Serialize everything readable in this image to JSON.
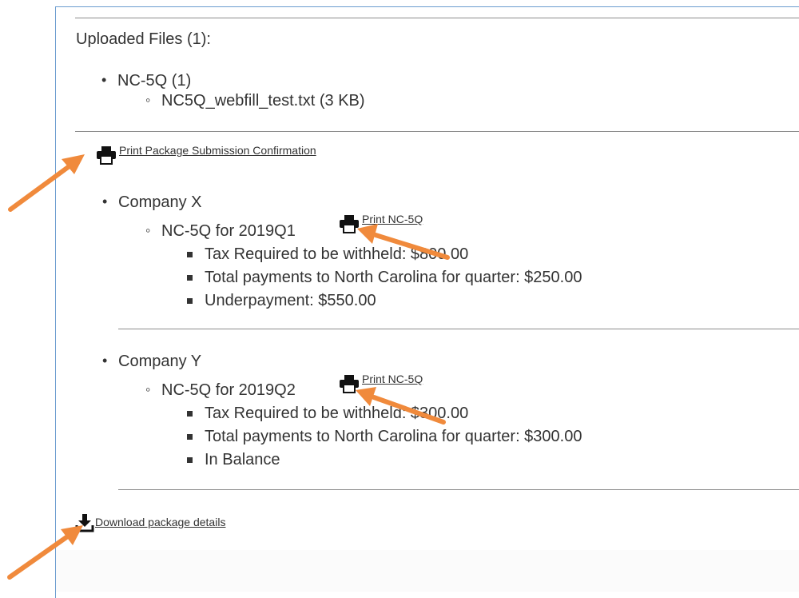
{
  "uploaded": {
    "heading": "Uploaded Files (1):",
    "form_item": "NC-5Q (1)",
    "file_item": "NC5Q_webfill_test.txt (3 KB)"
  },
  "actions": {
    "print_confirmation_label": "Print Package Submission Confirmation",
    "download_label": "Download package details"
  },
  "companies": [
    {
      "name": "Company X",
      "filing": "NC-5Q for 2019Q1",
      "print_label": "Print NC-5Q",
      "details": [
        "Tax Required to be withheld: $800.00",
        "Total payments to North Carolina for quarter: $250.00",
        "Underpayment: $550.00"
      ]
    },
    {
      "name": "Company Y",
      "filing": "NC-5Q for 2019Q2",
      "print_label": "Print NC-5Q",
      "details": [
        "Tax Required to be withheld: $300.00",
        "Total payments to North Carolina for quarter: $300.00",
        "In Balance"
      ]
    }
  ],
  "icons": [
    "printer-icon",
    "download-icon"
  ],
  "colors": {
    "annotation_arrow": "#f08a3c",
    "panel_border": "#6b9ccf",
    "text": "#333333"
  }
}
